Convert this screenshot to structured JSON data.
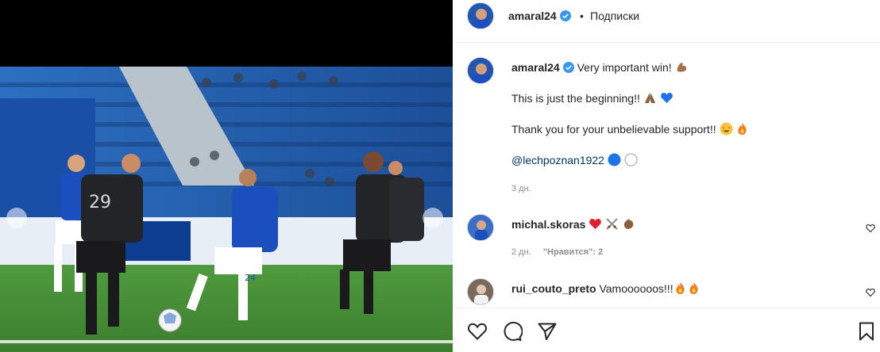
{
  "post": {
    "author": "amaral24",
    "follow_label": "Подписки",
    "separator": "•"
  },
  "caption": {
    "username": "amaral24",
    "line1": "Very important win!",
    "line2": "This is just the beginning!!",
    "line3": "Thank you for your unbelievable support!!",
    "mention": "@lechpoznan1922",
    "time": "3 дн."
  },
  "comments": [
    {
      "username": "michal.skoras",
      "text": "",
      "time": "2 дн.",
      "likes": "\"Нравится\": 2"
    },
    {
      "username": "rui_couto_preto",
      "text": "Vamoooooos!!!"
    }
  ],
  "icons": {
    "like": "heart-outline-icon",
    "comment": "speech-bubble-icon",
    "share": "paper-plane-icon",
    "save": "bookmark-icon"
  },
  "colors": {
    "verified": "#3897f0",
    "text": "#262626",
    "meta": "#8e8e8e",
    "mention": "#00376b",
    "jersey_blue": "#1b4fbd"
  }
}
